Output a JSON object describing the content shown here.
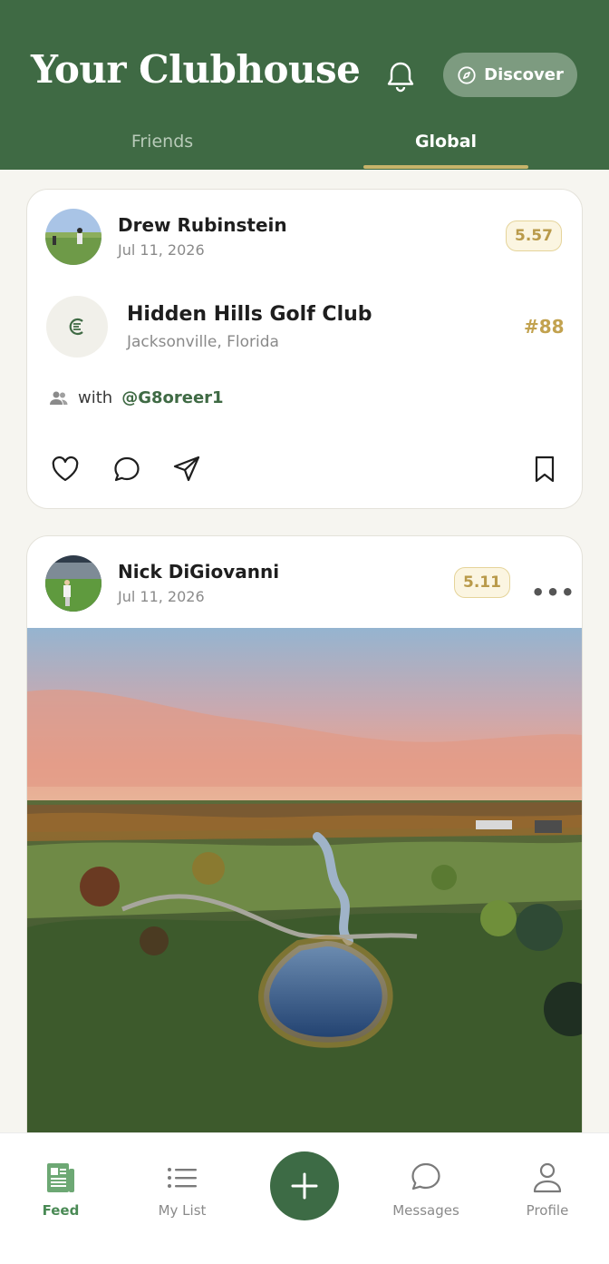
{
  "header": {
    "title": "Your Clubhouse",
    "discover_label": "Discover",
    "tabs": [
      {
        "label": "Friends",
        "active": false
      },
      {
        "label": "Global",
        "active": true
      }
    ]
  },
  "posts": [
    {
      "user": "Drew Rubinstein",
      "date": "Jul 11, 2026",
      "score": "5.57",
      "club": {
        "name": "Hidden Hills Golf Club",
        "location": "Jacksonville, Florida",
        "rank": "#88",
        "logo_text": "E"
      },
      "with_prefix": "with",
      "with_handle": "@G8oreer1"
    },
    {
      "user": "Nick DiGiovanni",
      "date": "Jul 11, 2026",
      "score": "5.11",
      "more_label": "•••"
    }
  ],
  "tabbar": {
    "items": [
      {
        "label": "Feed",
        "icon": "feed-icon",
        "active": true
      },
      {
        "label": "My List",
        "icon": "list-icon",
        "active": false
      },
      {
        "label": "Messages",
        "icon": "message-icon",
        "active": false
      },
      {
        "label": "Profile",
        "icon": "person-icon",
        "active": false
      }
    ],
    "fab_icon": "plus-icon"
  },
  "colors": {
    "brand_green": "#3f6a44",
    "accent_gold": "#c2a24f",
    "tab_underline": "#c7b46a"
  }
}
